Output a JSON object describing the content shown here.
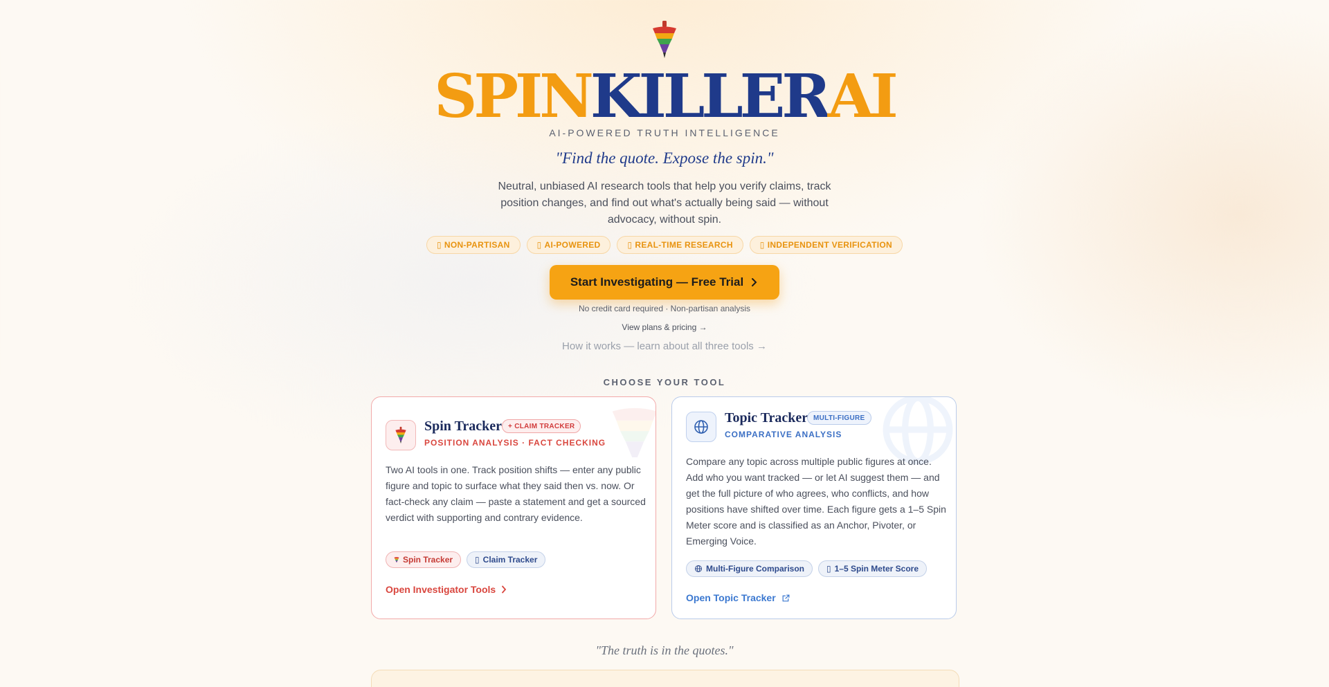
{
  "hero": {
    "brand_part1": "SPIN",
    "brand_part2": "KILLER",
    "brand_part3": "AI",
    "tagline": "AI-POWERED TRUTH INTELLIGENCE",
    "quote": "\"Find the quote. Expose the spin.\"",
    "description": "Neutral, unbiased AI research tools that help you verify claims, track position changes, and find out what's actually being said — without advocacy, without spin.",
    "pills": [
      {
        "icon": "▯",
        "label": "NON-PARTISAN"
      },
      {
        "icon": "▯",
        "label": "AI-POWERED"
      },
      {
        "icon": "▯",
        "label": "REAL-TIME RESEARCH"
      },
      {
        "icon": "▯",
        "label": "INDEPENDENT VERIFICATION"
      }
    ],
    "cta_label": "Start Investigating — Free Trial",
    "cta_note": "No credit card required · Non-partisan analysis",
    "pricing_link": "View plans & pricing →",
    "how_it_works_link": "How it works — learn about all three tools →"
  },
  "tools": {
    "heading": "CHOOSE YOUR TOOL",
    "spin": {
      "title": "Spin Tracker",
      "badge": "+ CLAIM TRACKER",
      "subtitle": "POSITION ANALYSIS · FACT CHECKING",
      "body": "Two AI tools in one. Track position shifts — enter any public figure and topic to surface what they said then vs. now. Or fact-check any claim — paste a statement and get a sourced verdict with supporting and contrary evidence.",
      "chip1": "Spin Tracker",
      "chip2_icon": "▯",
      "chip2": "Claim Tracker",
      "link": "Open Investigator Tools",
      "accent": "#d9463e"
    },
    "topic": {
      "title": "Topic Tracker",
      "badge": "MULTI-FIGURE",
      "subtitle": "COMPARATIVE ANALYSIS",
      "body": "Compare any topic across multiple public figures at once. Add who you want tracked — or let AI suggest them — and get the full picture of who agrees, who conflicts, and how positions have shifted over time. Each figure gets a 1–5 Spin Meter score and is classified as an Anchor, Pivoter, or Emerging Voice.",
      "chip1": "Multi-Figure Comparison",
      "chip2_icon": "▯",
      "chip2": "1–5 Spin Meter Score",
      "link": "Open Topic Tracker",
      "accent": "#3b78d0"
    }
  },
  "footer": {
    "quote": "\"The truth is in the quotes.\""
  },
  "colors": {
    "orange": "#f39c12",
    "navy": "#1f3a8a"
  }
}
